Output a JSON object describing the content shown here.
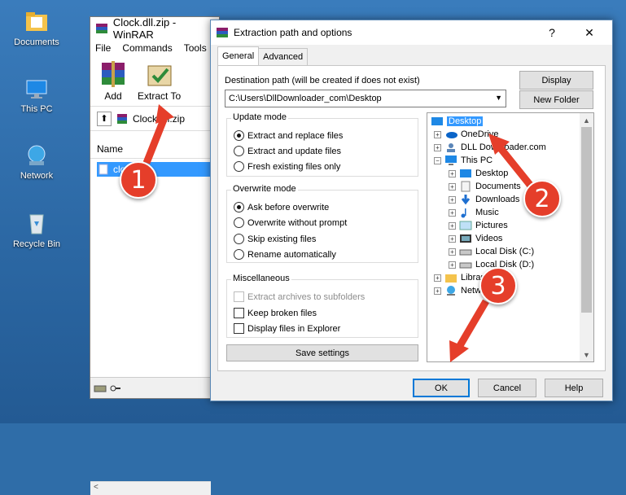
{
  "desktop": {
    "icons": [
      {
        "label": "Documents",
        "icon": "folder-documents-icon"
      },
      {
        "label": "This PC",
        "icon": "this-pc-icon"
      },
      {
        "label": "Network",
        "icon": "network-icon"
      },
      {
        "label": "Recycle Bin",
        "icon": "recycle-bin-icon"
      }
    ]
  },
  "winrar": {
    "title": "Clock.dll.zip - WinRAR",
    "menu": [
      "File",
      "Commands",
      "Tools"
    ],
    "toolbar": {
      "add_label": "Add",
      "extract_label": "Extract To"
    },
    "path_value": "Clock.dll.zip",
    "column_name": "Name",
    "selected_file": "clock.dll"
  },
  "dialog": {
    "title": "Extraction path and options",
    "help_glyph": "?",
    "close_glyph": "✕",
    "tabs": [
      "General",
      "Advanced"
    ],
    "destination_label": "Destination path (will be created if does not exist)",
    "destination_value": "C:\\Users\\DllDownloader_com\\Desktop",
    "display_button": "Display",
    "new_folder_button": "New Folder",
    "update_mode": {
      "title": "Update mode",
      "options": [
        "Extract and replace files",
        "Extract and update files",
        "Fresh existing files only"
      ],
      "selected_index": 0
    },
    "overwrite_mode": {
      "title": "Overwrite mode",
      "options": [
        "Ask before overwrite",
        "Overwrite without prompt",
        "Skip existing files",
        "Rename automatically"
      ],
      "selected_index": 0
    },
    "miscellaneous": {
      "title": "Miscellaneous",
      "options": [
        "Extract archives to subfolders",
        "Keep broken files",
        "Display files in Explorer"
      ]
    },
    "save_settings_button": "Save settings",
    "tree": [
      {
        "label": "Desktop",
        "icon": "desktop-folder-icon",
        "selected": true
      },
      {
        "label": "OneDrive",
        "icon": "onedrive-icon"
      },
      {
        "label": "DLL Downloader.com",
        "icon": "user-icon"
      },
      {
        "label": "This PC",
        "icon": "this-pc-icon"
      },
      {
        "label": "Desktop",
        "icon": "desktop-folder-icon"
      },
      {
        "label": "Documents",
        "icon": "documents-icon"
      },
      {
        "label": "Downloads",
        "icon": "downloads-icon"
      },
      {
        "label": "Music",
        "icon": "music-icon"
      },
      {
        "label": "Pictures",
        "icon": "pictures-icon"
      },
      {
        "label": "Videos",
        "icon": "videos-icon"
      },
      {
        "label": "Local Disk (C:)",
        "icon": "drive-icon"
      },
      {
        "label": "Local Disk (D:)",
        "icon": "drive-icon"
      },
      {
        "label": "Libraries",
        "icon": "libraries-icon"
      },
      {
        "label": "Network",
        "icon": "network-icon"
      }
    ],
    "ok_button": "OK",
    "cancel_button": "Cancel",
    "help_button": "Help"
  },
  "callouts": [
    "1",
    "2",
    "3"
  ],
  "colors": {
    "callout": "#e53e2a",
    "selection": "#3399ff"
  }
}
